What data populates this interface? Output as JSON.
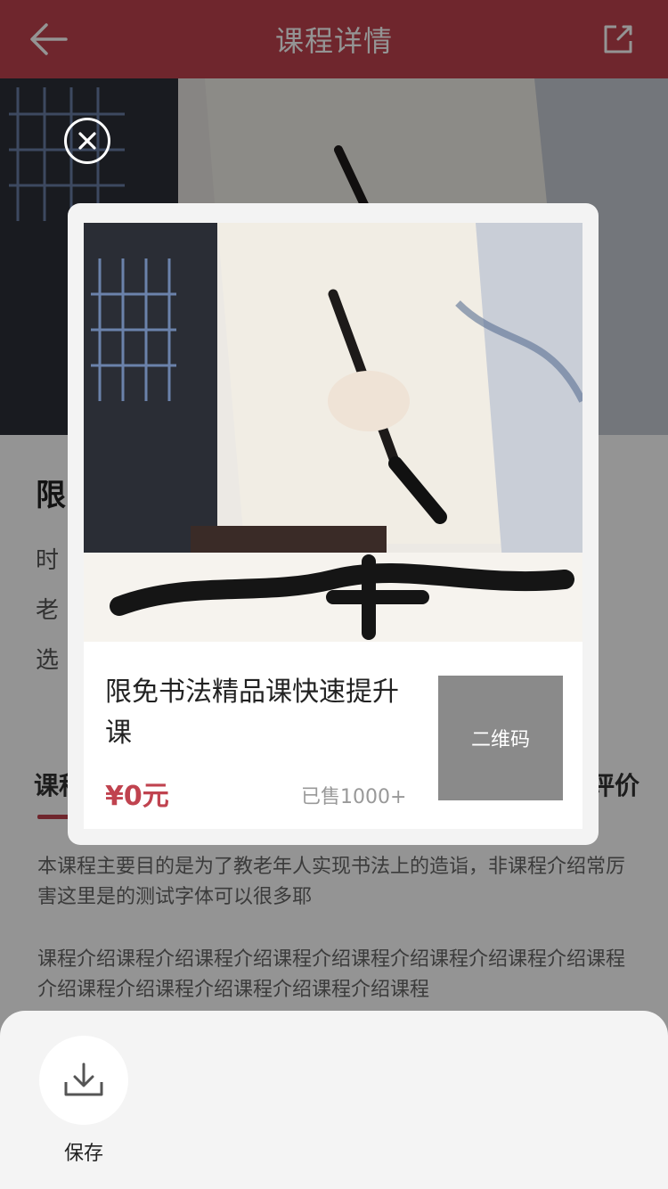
{
  "header": {
    "title": "课程详情",
    "back_icon": "back-arrow-icon",
    "share_icon": "share-icon"
  },
  "course": {
    "title_partial": "限",
    "info_lines": [
      "时",
      "老",
      "选"
    ]
  },
  "tabs": {
    "left_partial": "课程",
    "right_partial": "评价"
  },
  "description": {
    "para1": "本课程主要目的是为了教老年人实现书法上的造诣，非课程介绍常厉害这里是的测试字体可以很多耶",
    "para2": "课程介绍课程介绍课程介绍课程介绍课程介绍课程介绍课程介绍课程介绍课程介绍课程介绍课程介绍课程介绍课程"
  },
  "poster": {
    "title": "限免书法精品课快速提升课",
    "price": "¥0元",
    "sold": "已售1000+",
    "qr_label": "二维码"
  },
  "sheet": {
    "save_label": "保存",
    "save_icon": "download-icon"
  },
  "colors": {
    "brand": "#c0434f",
    "overlay": "rgba(0,0,0,0.42)"
  }
}
